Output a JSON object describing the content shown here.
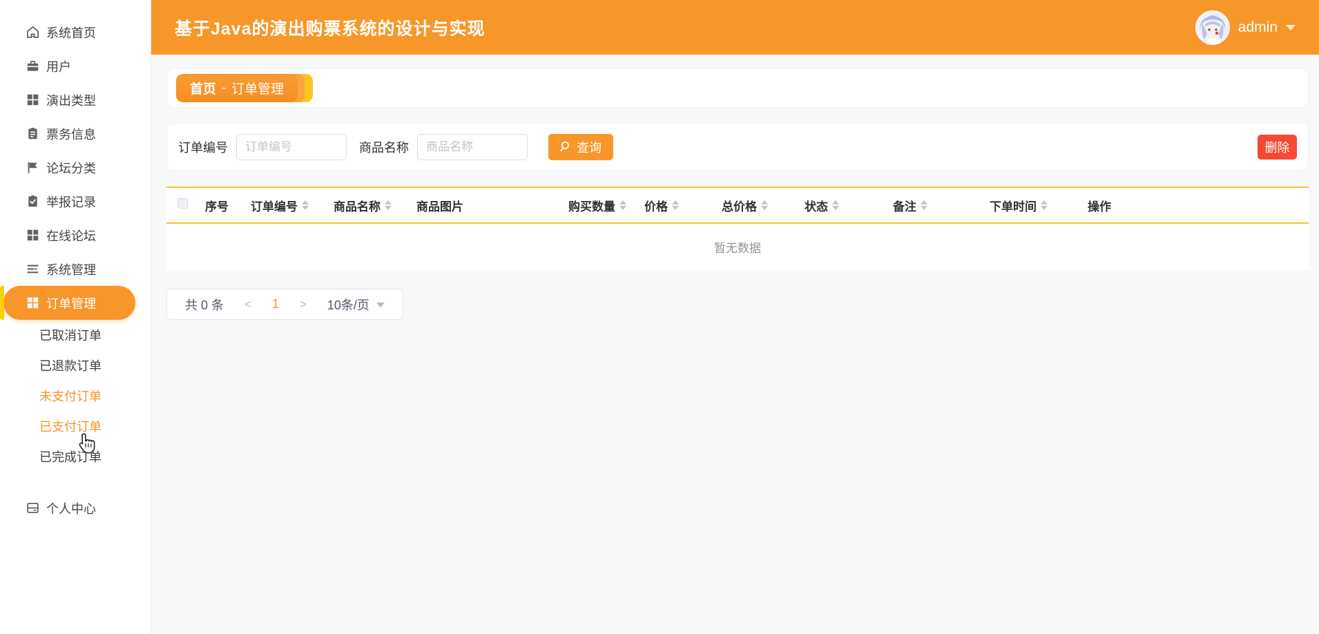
{
  "header": {
    "title": "基于Java的演出购票系统的设计与实现",
    "username": "admin"
  },
  "sidebar": {
    "items": [
      {
        "name": "home",
        "label": "系统首页",
        "icon": "home-icon"
      },
      {
        "name": "users",
        "label": "用户",
        "icon": "briefcase-icon"
      },
      {
        "name": "show-types",
        "label": "演出类型",
        "icon": "grid-icon"
      },
      {
        "name": "ticket-info",
        "label": "票务信息",
        "icon": "clipboard-icon"
      },
      {
        "name": "forum-categories",
        "label": "论坛分类",
        "icon": "flag-icon"
      },
      {
        "name": "report-records",
        "label": "举报记录",
        "icon": "clipboard-check-icon"
      },
      {
        "name": "online-forum",
        "label": "在线论坛",
        "icon": "grid-icon"
      },
      {
        "name": "system-management",
        "label": "系统管理",
        "icon": "list-arrow-icon"
      },
      {
        "name": "order-management",
        "label": "订单管理",
        "icon": "grid-icon",
        "active": true
      },
      {
        "name": "cancelled-orders",
        "label": "已取消订单",
        "sub": true
      },
      {
        "name": "refunded-orders",
        "label": "已退款订单",
        "sub": true
      },
      {
        "name": "unpaid-orders",
        "label": "未支付订单",
        "sub": true,
        "highlight": true
      },
      {
        "name": "paid-orders",
        "label": "已支付订单",
        "sub": true,
        "highlight": true
      },
      {
        "name": "completed-orders",
        "label": "已完成订单",
        "sub": true
      },
      {
        "name": "personal-center",
        "label": "个人中心",
        "icon": "window-icon",
        "gapAbove": true
      }
    ]
  },
  "breadcrumb": {
    "home": "首页",
    "separator": "-",
    "current": "订单管理"
  },
  "filters": {
    "order_no_label": "订单编号",
    "order_no_placeholder": "订单编号",
    "order_no_value": "",
    "product_name_label": "商品名称",
    "product_name_placeholder": "商品名称",
    "product_name_value": "",
    "search_label": "查询",
    "delete_label": "删除"
  },
  "table": {
    "columns": [
      {
        "label": "序号",
        "sortable": false
      },
      {
        "label": "订单编号",
        "sortable": true
      },
      {
        "label": "商品名称",
        "sortable": true
      },
      {
        "label": "商品图片",
        "sortable": false
      },
      {
        "label": "购买数量",
        "sortable": true
      },
      {
        "label": "价格",
        "sortable": true
      },
      {
        "label": "总价格",
        "sortable": true
      },
      {
        "label": "状态",
        "sortable": true
      },
      {
        "label": "备注",
        "sortable": true
      },
      {
        "label": "下单时间",
        "sortable": true
      },
      {
        "label": "操作",
        "sortable": false
      }
    ],
    "empty_text": "暂无数据",
    "rows": []
  },
  "pagination": {
    "total_text": "共 0 条",
    "prev": "<",
    "current_page": "1",
    "next": ">",
    "page_size": "10条/页"
  },
  "colors": {
    "accent_orange": "#f89729",
    "accent_yellow": "#eec42e",
    "danger_red": "#f54a31"
  }
}
